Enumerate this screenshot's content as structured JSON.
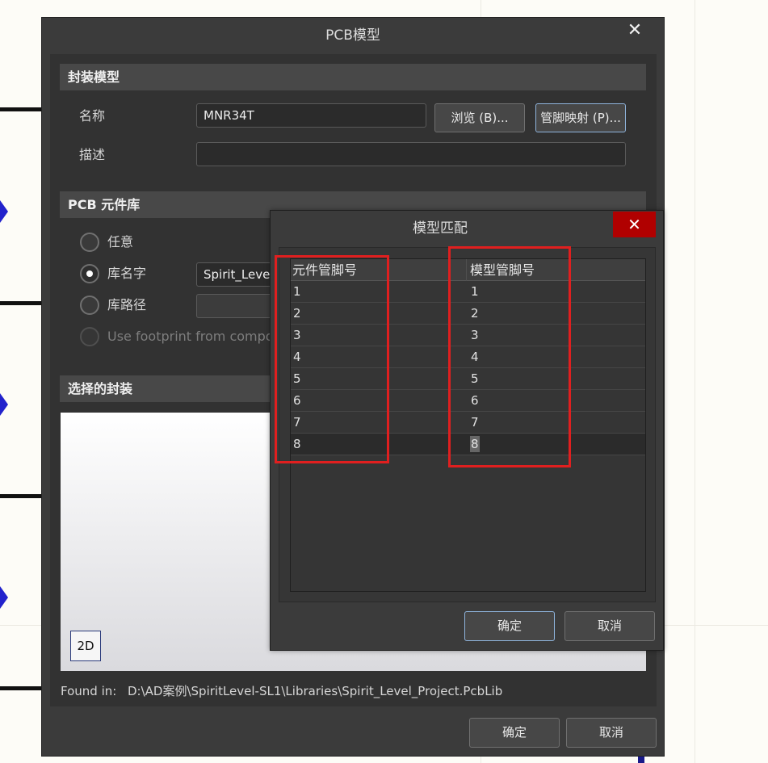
{
  "main_dialog": {
    "title": "PCB模型",
    "close_glyph": "✕",
    "footprint_section": {
      "header": "封装模型",
      "name_label": "名称",
      "name_value": "MNR34T",
      "browse_button": "浏览 (B)...",
      "pinmap_button": "管脚映射 (P)...",
      "desc_label": "描述",
      "desc_value": ""
    },
    "library_section": {
      "header": "PCB 元件库",
      "options": [
        {
          "label": "任意",
          "checked": false
        },
        {
          "label": "库名字",
          "checked": true
        },
        {
          "label": "库路径",
          "checked": false
        },
        {
          "label": "Use footprint from compo",
          "checked": false,
          "disabled": true
        }
      ],
      "libname_value": "Spirit_Level"
    },
    "selected_section": {
      "header": "选择的封装",
      "view_toggle": "2D"
    },
    "found_in_label": "Found in:",
    "found_in_path": "D:\\AD案例\\SpiritLevel-SL1\\Libraries\\Spirit_Level_Project.PcbLib",
    "ok_button": "确定",
    "cancel_button": "取消"
  },
  "match_dialog": {
    "title": "模型匹配",
    "close_glyph": "✕",
    "columns": [
      "元件管脚号",
      "模型管脚号"
    ],
    "rows": [
      [
        "1",
        "1"
      ],
      [
        "2",
        "2"
      ],
      [
        "3",
        "3"
      ],
      [
        "4",
        "4"
      ],
      [
        "5",
        "5"
      ],
      [
        "6",
        "6"
      ],
      [
        "7",
        "7"
      ],
      [
        "8",
        "8"
      ]
    ],
    "selected_row": 7,
    "ok_button": "确定",
    "cancel_button": "取消"
  },
  "colors": {
    "dialog_bg": "#3b3b3b",
    "section_header_bg": "#484848",
    "close_red": "#b00000",
    "annotation_red": "#e01f1f",
    "focus_border": "#8fb4dc"
  }
}
